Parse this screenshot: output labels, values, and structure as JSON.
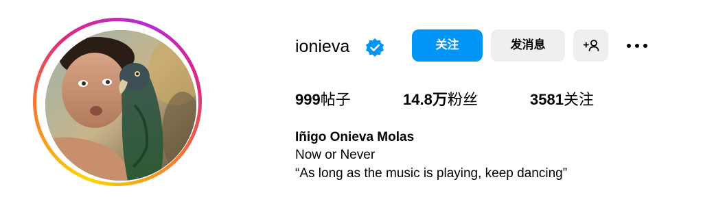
{
  "profile": {
    "username": "ionieva",
    "verified": true,
    "full_name": "Iñigo Onieva Molas",
    "bio_lines": [
      "Now or Never",
      "“As long as the music is playing, keep dancing”"
    ]
  },
  "actions": {
    "follow_label": "关注",
    "message_label": "发消息",
    "suggest_label": "+♀",
    "more_icon": "more-horizontal-icon"
  },
  "stats": {
    "posts_count": "999",
    "posts_label": "帖子",
    "followers_count": "14.8万",
    "followers_label": "粉丝",
    "following_count": "3581",
    "following_label": "关注"
  },
  "colors": {
    "follow_button_bg": "#0095f6",
    "secondary_button_bg": "#efefef",
    "verified_badge": "#0095f6"
  }
}
